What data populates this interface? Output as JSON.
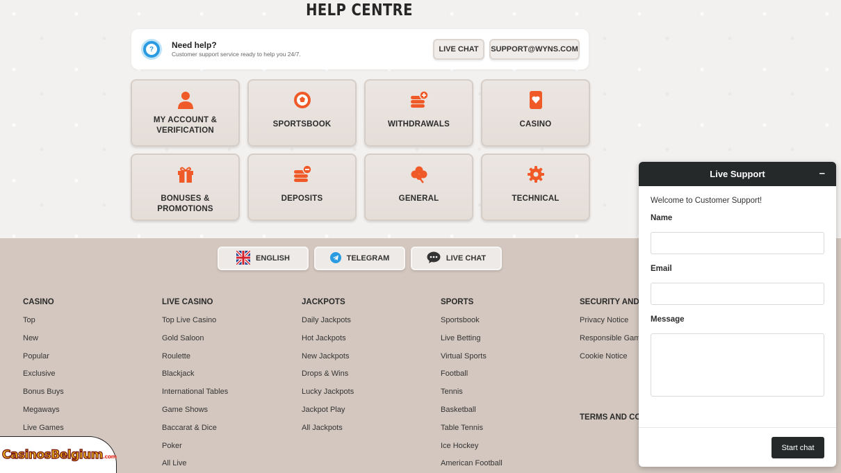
{
  "help_centre": {
    "title": "HELP CENTRE",
    "need_help_title": "Need help?",
    "need_help_subtitle": "Customer support service ready to help you 24/7.",
    "live_chat_label": "LIVE CHAT",
    "email_label": "SUPPORT@WYNS.COM"
  },
  "categories": [
    {
      "label_line1": "MY ACCOUNT &",
      "label_line2": "VERIFICATION",
      "icon": "user-icon"
    },
    {
      "label_line1": "SPORTSBOOK",
      "label_line2": "",
      "icon": "soccer-ball-icon"
    },
    {
      "label_line1": "WITHDRAWALS",
      "label_line2": "",
      "icon": "coins-plus-icon"
    },
    {
      "label_line1": "CASINO",
      "label_line2": "",
      "icon": "playing-card-icon"
    },
    {
      "label_line1": "BONUSES & PROMOTIONS",
      "label_line2": "",
      "icon": "gift-icon"
    },
    {
      "label_line1": "DEPOSITS",
      "label_line2": "",
      "icon": "coins-minus-icon"
    },
    {
      "label_line1": "GENERAL",
      "label_line2": "",
      "icon": "clover-icon"
    },
    {
      "label_line1": "TECHNICAL",
      "label_line2": "",
      "icon": "gear-icon"
    }
  ],
  "footer": {
    "buttons": [
      {
        "label": "ENGLISH",
        "icon": "uk-flag-icon"
      },
      {
        "label": "TELEGRAM",
        "icon": "telegram-icon"
      },
      {
        "label": "LIVE CHAT",
        "icon": "chat-bubble-icon"
      }
    ],
    "columns": [
      {
        "heading": "CASINO",
        "items": [
          "Top",
          "New",
          "Popular",
          "Exclusive",
          "Bonus Buys",
          "Megaways",
          "Live Games"
        ]
      },
      {
        "heading": "LIVE CASINO",
        "items": [
          "Top Live Casino",
          "Gold Saloon",
          "Roulette",
          "Blackjack",
          "International Tables",
          "Game Shows",
          "Baccarat & Dice",
          "Poker",
          "All Live"
        ]
      },
      {
        "heading": "JACKPOTS",
        "items": [
          "Daily Jackpots",
          "Hot Jackpots",
          "New Jackpots",
          "Drops & Wins",
          "Lucky Jackpots",
          "Jackpot Play",
          "All Jackpots"
        ]
      },
      {
        "heading": "SPORTS",
        "items": [
          "Sportsbook",
          "Live Betting",
          "Virtual Sports",
          "Football",
          "Tennis",
          "Basketball",
          "Table Tennis",
          "Ice Hockey",
          "American Football"
        ]
      },
      {
        "heading": "SECURITY AND PRI",
        "items": [
          "Privacy Notice",
          "Responsible Gaming",
          "Cookie Notice"
        ]
      }
    ],
    "terms_heading": "TERMS AND CONDI"
  },
  "live_support": {
    "title": "Live Support",
    "minimize": "–",
    "welcome": "Welcome to Customer Support!",
    "name_label": "Name",
    "email_label": "Email",
    "message_label": "Message",
    "start_button": "Start chat"
  },
  "watermark": {
    "text": "CasinosBelgium",
    "suffix": ".com"
  },
  "colors": {
    "accent": "#f05a28",
    "footer_bg": "#d3c7bf",
    "chat_header": "#25292a"
  }
}
